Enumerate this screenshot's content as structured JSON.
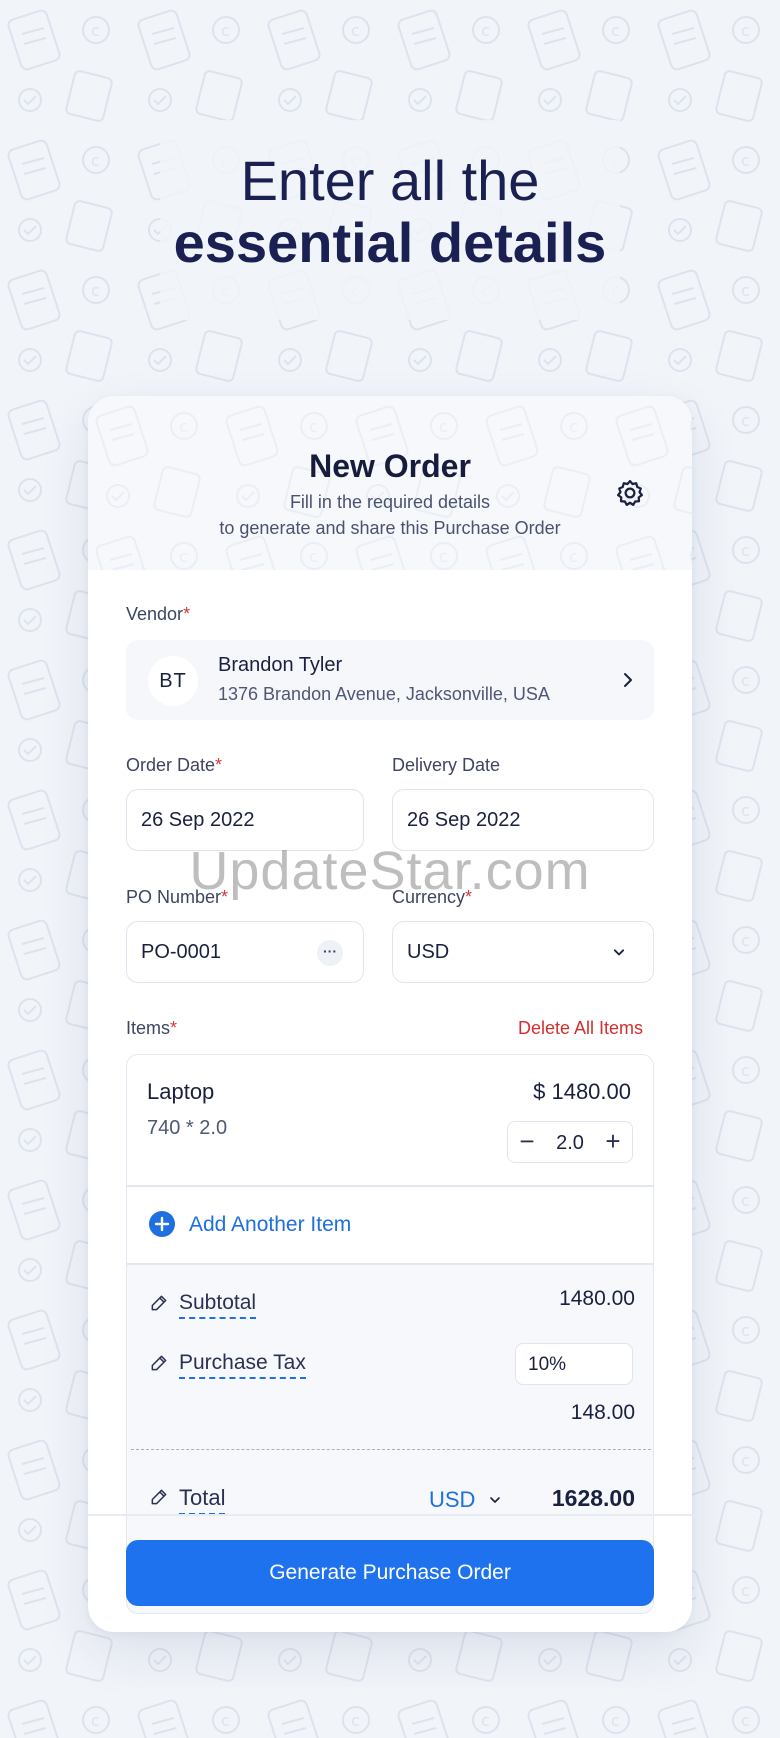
{
  "headline": {
    "line1": "Enter all the",
    "line2": "essential details"
  },
  "order": {
    "title": "New Order",
    "subtitle_line1": "Fill in the required details",
    "subtitle_line2": "to generate and share this Purchase Order"
  },
  "vendor": {
    "label": "Vendor",
    "initials": "BT",
    "name": "Brandon Tyler",
    "address": "1376 Brandon Avenue, Jacksonville, USA"
  },
  "order_date": {
    "label": "Order Date",
    "value": "26 Sep 2022"
  },
  "delivery_date": {
    "label": "Delivery Date",
    "value": "26 Sep 2022"
  },
  "po_number": {
    "label": "PO Number",
    "value": "PO-0001",
    "more": "···"
  },
  "currency": {
    "label": "Currency",
    "value": "USD"
  },
  "required_mark": "*",
  "items": {
    "label": "Items",
    "delete_all": "Delete All Items",
    "list": [
      {
        "name": "Laptop",
        "price": "$ 1480.00",
        "calc": "740 * 2.0",
        "qty": "2.0"
      }
    ],
    "add_label": "Add Another Item"
  },
  "summary": {
    "subtotal_label": "Subtotal",
    "subtotal_value": "1480.00",
    "tax_label": "Purchase Tax",
    "tax_rate": "10%",
    "tax_value": "148.00",
    "total_label": "Total",
    "total_currency": "USD",
    "total_value": "1628.00"
  },
  "stepper": {
    "minus": "−",
    "plus": "+"
  },
  "generate_label": "Generate Purchase Order",
  "watermark": "UpdateStar.com",
  "colors": {
    "accent": "#1f72ee",
    "required": "#d43a3a",
    "delete": "#d22f2f",
    "title": "#1a2052"
  }
}
